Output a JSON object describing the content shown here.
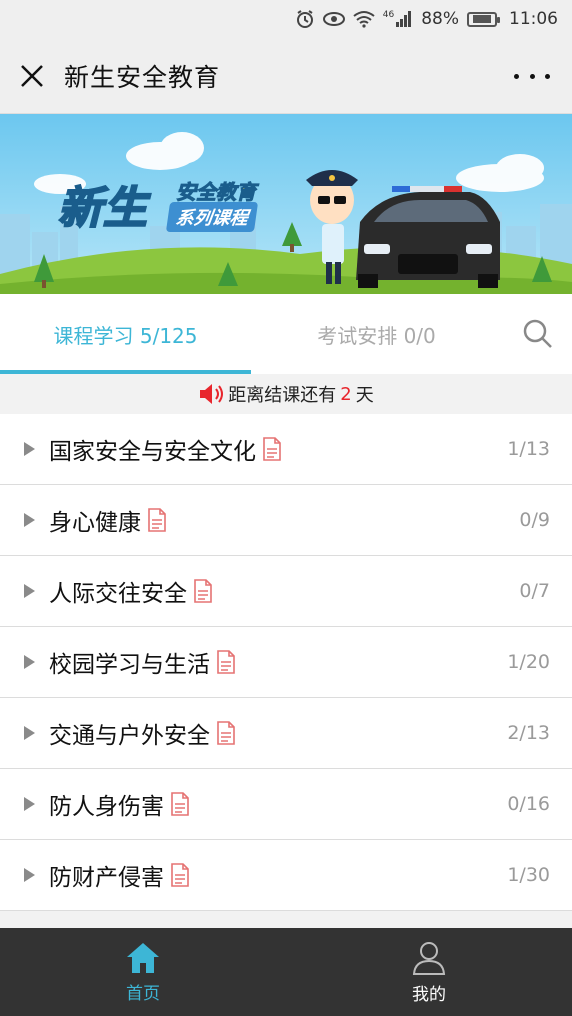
{
  "status_bar": {
    "network": "46",
    "battery_percent": "88%",
    "time": "11:06",
    "icons": [
      "alarm-icon",
      "eye-icon",
      "wifi-icon",
      "signal-icon",
      "battery-icon"
    ]
  },
  "title_bar": {
    "title": "新生安全教育",
    "close_icon": "close-icon",
    "more_icon": "more-icon"
  },
  "banner": {
    "title": "新生",
    "subtitle_top": "安全教育",
    "subtitle_bottom": "系列课程",
    "colors": {
      "sky": "#7fd0f2",
      "grass": "#8cc63f",
      "title_fill": "#ffd52e"
    }
  },
  "tabs": [
    {
      "label": "课程学习 5/125",
      "active": true
    },
    {
      "label": "考试安排 0/0",
      "active": false
    }
  ],
  "notice": {
    "before": "距离结课还有",
    "days": "2",
    "after": "天"
  },
  "courses": [
    {
      "title": "国家安全与安全文化",
      "progress": "1/13"
    },
    {
      "title": "身心健康",
      "progress": "0/9"
    },
    {
      "title": "人际交往安全",
      "progress": "0/7"
    },
    {
      "title": "校园学习与生活",
      "progress": "1/20"
    },
    {
      "title": "交通与户外安全",
      "progress": "2/13"
    },
    {
      "title": "防人身伤害",
      "progress": "0/16"
    },
    {
      "title": "防财产侵害",
      "progress": "1/30"
    }
  ],
  "bottom_nav": [
    {
      "label": "首页",
      "icon": "home-icon",
      "active": true
    },
    {
      "label": "我的",
      "icon": "user-icon",
      "active": false
    }
  ],
  "colors": {
    "accent": "#3db6d6",
    "nav_bg": "#333333",
    "notice_red": "#e8262d",
    "doc_icon": "#e57373"
  }
}
